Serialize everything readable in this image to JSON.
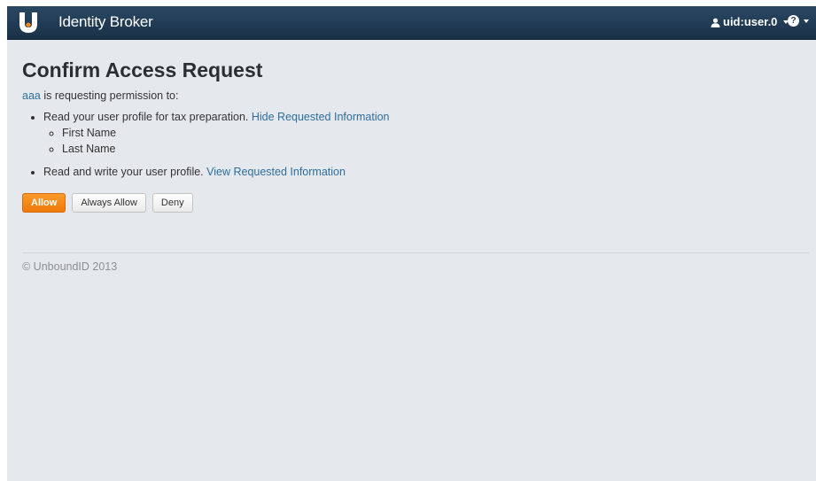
{
  "navbar": {
    "brand": "Identity Broker",
    "user_label": "uid:user.0",
    "help_icon_glyph": "?"
  },
  "page": {
    "title": "Confirm Access Request",
    "client_name": "aaa",
    "intro_text": " is requesting permission to:"
  },
  "permissions": [
    {
      "text": "Read your user profile for tax preparation. ",
      "link": "Hide Requested Information",
      "attributes": [
        "First Name",
        "Last Name"
      ]
    },
    {
      "text": "Read and write your user profile. ",
      "link": "View Requested Information",
      "attributes": []
    }
  ],
  "actions": {
    "allow": "Allow",
    "always_allow": "Always Allow",
    "deny": "Deny"
  },
  "footer": {
    "copyright": "© UnboundID 2013"
  },
  "colors": {
    "navbar": "#1f3a55",
    "background": "#e5e8ec",
    "link": "#2e6f9e",
    "primary_button": "#f58a1a",
    "logo_accent": "#f58a1a"
  }
}
